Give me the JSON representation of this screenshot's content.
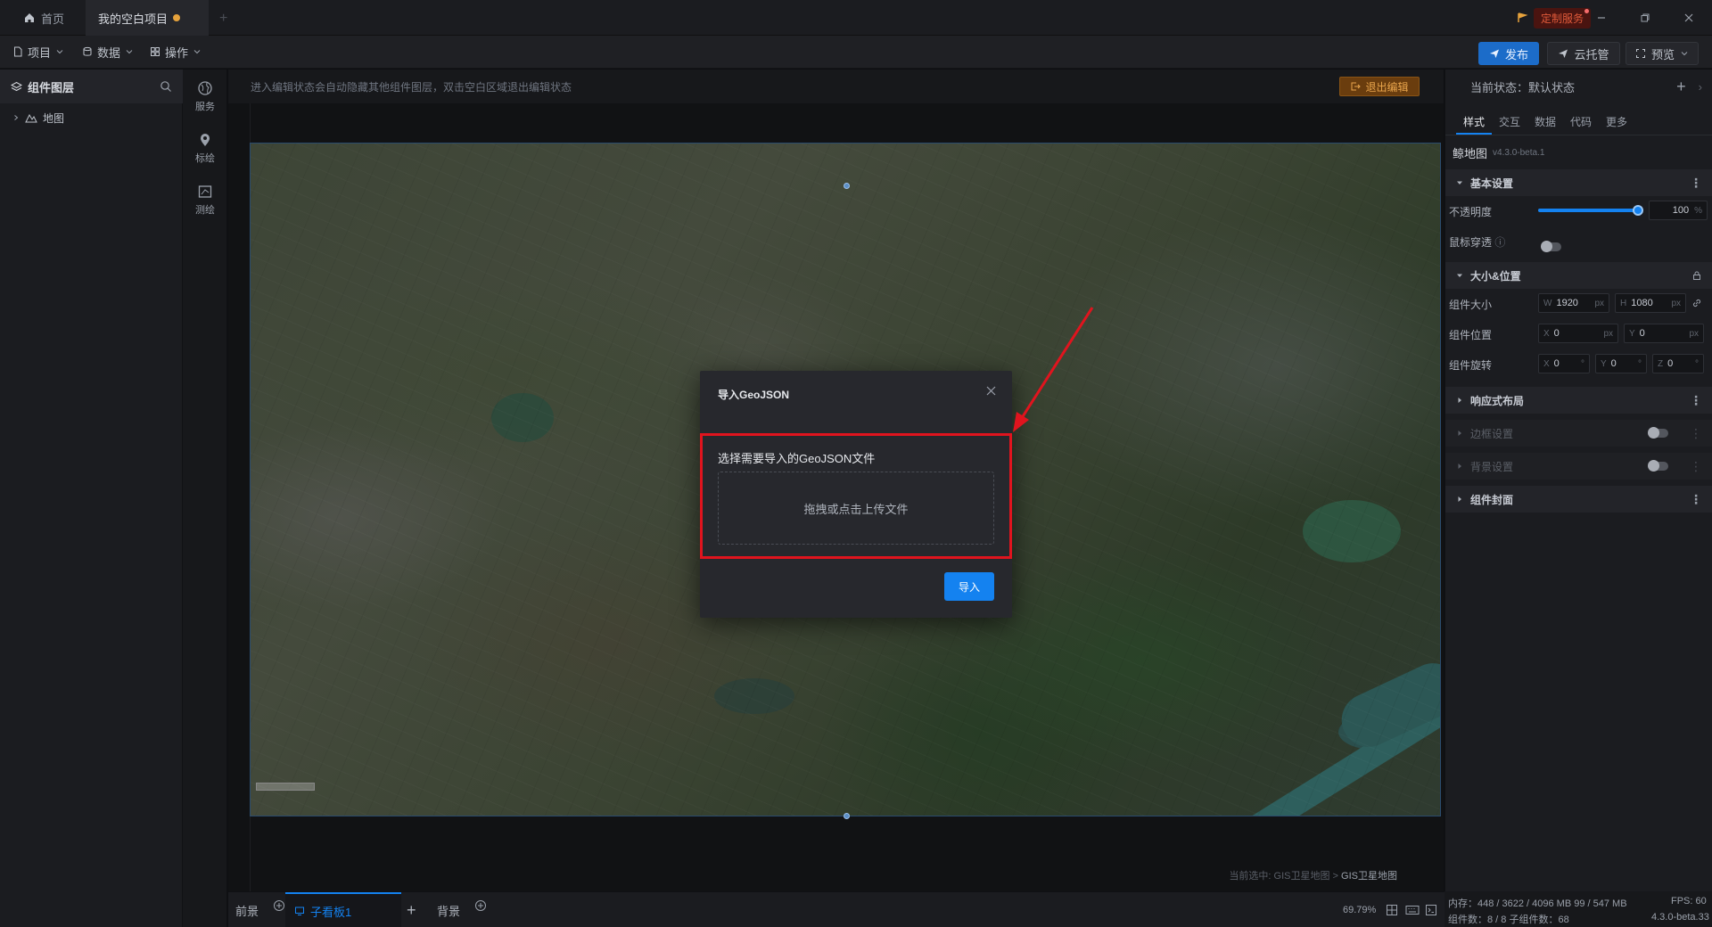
{
  "titlebar": {
    "tabs": [
      {
        "label": "首页"
      },
      {
        "label": "我的空白项目"
      }
    ],
    "custom_service": "定制服务"
  },
  "toolbar": {
    "menus": [
      "项目",
      "数据",
      "操作"
    ],
    "publish": "发布",
    "cloud_host": "云托管",
    "preview": "预览"
  },
  "left_panel": {
    "title": "组件图层",
    "items": [
      {
        "label": "地图"
      }
    ]
  },
  "icon_strip": [
    {
      "label": "服务",
      "icon": "globe-icon"
    },
    {
      "label": "标绘",
      "icon": "pin-icon"
    },
    {
      "label": "测绘",
      "icon": "measure-icon"
    }
  ],
  "canvas": {
    "hint": "进入编辑状态会自动隐藏其他组件图层，双击空白区域退出编辑状态",
    "exit_edit": "退出编辑",
    "breadcrumb_prefix": "当前选中: GIS卫星地图 > ",
    "breadcrumb_current": "GIS卫星地图"
  },
  "dialog": {
    "title": "导入GeoJSON",
    "label": "选择需要导入的GeoJSON文件",
    "drop_text": "拖拽或点击上传文件",
    "import_button": "导入"
  },
  "right_panel": {
    "state_label": "当前状态：默认状态",
    "tabs": [
      "样式",
      "交互",
      "数据",
      "代码",
      "更多"
    ],
    "component_name": "鲸地图",
    "component_version": "v4.3.0-beta.1",
    "sections": {
      "basic": "基本设置",
      "size_pos": "大小&位置",
      "responsive": "响应式布局",
      "border": "边框设置",
      "background": "背景设置",
      "encapsulate": "组件封面"
    },
    "props": {
      "opacity_label": "不透明度",
      "opacity_value": "100",
      "opacity_unit": "%",
      "opacity_level": 1.0,
      "mouse_through_label": "鼠标穿透",
      "size_label": "组件大小",
      "width": "1920",
      "height": "1080",
      "pos_label": "组件位置",
      "x": "0",
      "y": "0",
      "rotate_label": "组件旋转",
      "rx": "0",
      "ry": "0",
      "rz": "0",
      "unit_px": "px",
      "unit_deg": "°"
    }
  },
  "bottom": {
    "front": "前景",
    "child_panel": "子看板1",
    "background": "背景",
    "zoom": "69.79%"
  },
  "status": {
    "memory": "内存：448 / 3622 / 4096 MB  99 / 547 MB",
    "fps": "FPS:  60",
    "components": "组件数：8 / 8   子组件数：68",
    "version": "4.3.0-beta.33"
  },
  "colors": {
    "accent": "#1482f0",
    "highlight": "#e0141e",
    "exit_edit": "#e9a54c"
  }
}
